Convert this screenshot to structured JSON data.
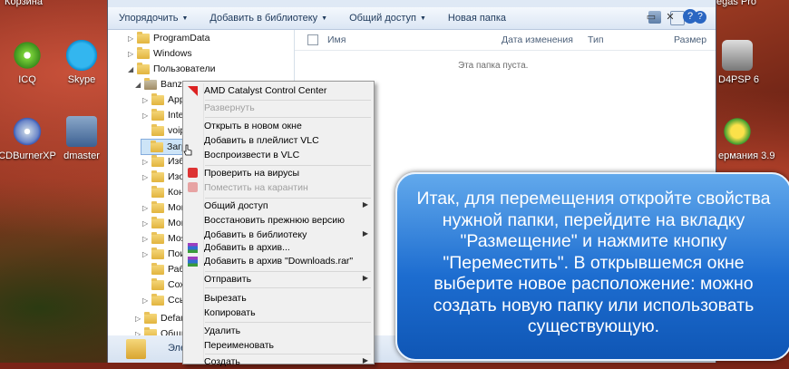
{
  "desktop": {
    "icons": [
      {
        "label": "Корзина"
      },
      {
        "label": "ICQ"
      },
      {
        "label": "Skype"
      },
      {
        "label": "CDBurnerXP"
      },
      {
        "label": "dmaster"
      },
      {
        "label": "egas Pro"
      },
      {
        "label": "D4PSP 6"
      },
      {
        "label": "ермания 3.9"
      }
    ]
  },
  "toolbar": {
    "organize": "Упорядочить",
    "library": "Добавить в библиотеку",
    "share": "Общий доступ",
    "new_folder": "Новая папка"
  },
  "nav_tree": [
    {
      "label": "ProgramData"
    },
    {
      "label": "Windows"
    },
    {
      "label": "Пользователи"
    },
    {
      "label": "Banzay"
    },
    {
      "label": "AppD"
    },
    {
      "label": "Intel"
    },
    {
      "label": "voip"
    },
    {
      "label": "Загр"
    },
    {
      "label": "Избр"
    },
    {
      "label": "Изоб"
    },
    {
      "label": "Конт"
    },
    {
      "label": "Мои"
    },
    {
      "label": "Мои"
    },
    {
      "label": "Моя"
    },
    {
      "label": "Поис"
    },
    {
      "label": "Рабо"
    },
    {
      "label": "Сохр"
    },
    {
      "label": "Ссыл"
    },
    {
      "label": "Defaul"
    },
    {
      "label": "Общи"
    },
    {
      "label": "Эле"
    }
  ],
  "columns": {
    "name": "Имя",
    "date": "Дата изменения",
    "type": "Тип",
    "size": "Размер"
  },
  "empty_text": "Эта папка пуста.",
  "context_menu": {
    "items": [
      {
        "label": "AMD Catalyst Control Center"
      },
      {
        "label": "Развернуть"
      },
      {
        "label": "Открыть в новом окне"
      },
      {
        "label": "Добавить в плейлист VLC"
      },
      {
        "label": "Воспроизвести в VLC"
      },
      {
        "label": "Проверить на вирусы"
      },
      {
        "label": "Поместить на карантин"
      },
      {
        "label": "Общий доступ"
      },
      {
        "label": "Восстановить прежнюю версию"
      },
      {
        "label": "Добавить в библиотеку"
      },
      {
        "label": "Добавить в архив..."
      },
      {
        "label": "Добавить в архив \"Downloads.rar\""
      },
      {
        "label": "Отправить"
      },
      {
        "label": "Вырезать"
      },
      {
        "label": "Копировать"
      },
      {
        "label": "Удалить"
      },
      {
        "label": "Переименовать"
      },
      {
        "label": "Создать"
      }
    ]
  },
  "callout": {
    "text": "Итак, для перемещения откройте свойства нужной папки, перейдите на вкладку \"Размещение\" и нажмите кнопку \"Переместить\". В открывшемся окне выберите новое расположение: можно создать новую папку или использовать существующую."
  },
  "colors": {
    "callout_blue": "#1d6dd0",
    "selection": "#cde4f7"
  }
}
